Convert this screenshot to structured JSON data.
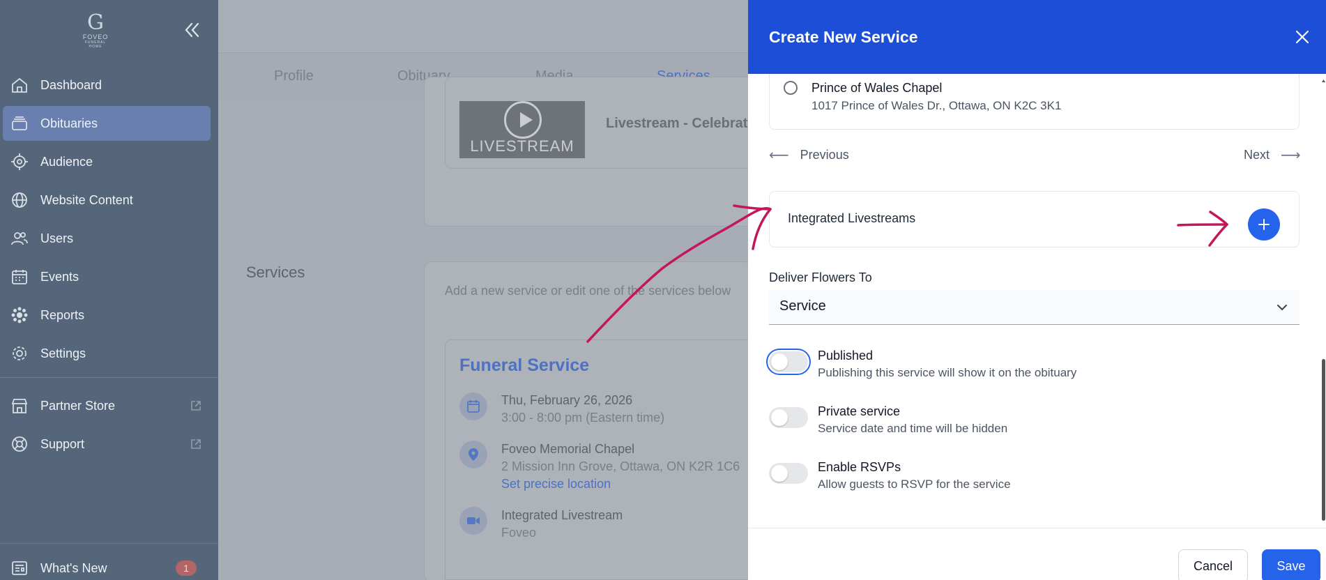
{
  "sidebar": {
    "logo": {
      "mark": "G",
      "name": "FOVEO",
      "sub": "FUNERAL HOME"
    },
    "items": [
      {
        "label": "Dashboard",
        "icon": "home-icon"
      },
      {
        "label": "Obituaries",
        "icon": "stack-icon",
        "active": true
      },
      {
        "label": "Audience",
        "icon": "target-icon"
      },
      {
        "label": "Website Content",
        "icon": "globe-icon"
      },
      {
        "label": "Users",
        "icon": "users-icon"
      },
      {
        "label": "Events",
        "icon": "calendar-icon"
      },
      {
        "label": "Reports",
        "icon": "reports-icon"
      },
      {
        "label": "Settings",
        "icon": "gear-icon"
      }
    ],
    "external": [
      {
        "label": "Partner Store",
        "icon": "store-icon"
      },
      {
        "label": "Support",
        "icon": "lifebuoy-icon"
      }
    ],
    "whats_new": {
      "label": "What's New",
      "badge": "1"
    }
  },
  "main": {
    "tabs": [
      "Profile",
      "Obituary",
      "Media",
      "Services"
    ],
    "active_tab": "Services",
    "livestream_thumb": "LIVESTREAM",
    "livestream_title": "Livestream - Celebrat",
    "section_title": "Services",
    "section_desc": "Add a new service or edit one of the services below",
    "service": {
      "title": "Funeral Service",
      "date": "Thu, February 26, 2026",
      "time": "3:00 - 8:00 pm (Eastern time)",
      "venue": "Foveo Memorial Chapel",
      "address": "2 Mission Inn Grove, Ottawa, ON K2R 1C6",
      "location_link": "Set precise location",
      "livestream_label": "Integrated Livestream",
      "livestream_provider": "Foveo"
    }
  },
  "modal": {
    "title": "Create New Service",
    "venue": {
      "name": "Prince of Wales Chapel",
      "address": "1017 Prince of Wales Dr., Ottawa, ON K2C 3K1"
    },
    "pager": {
      "previous": "Previous",
      "next": "Next"
    },
    "livestreams_label": "Integrated Livestreams",
    "deliver_label": "Deliver Flowers To",
    "deliver_value": "Service",
    "toggles": [
      {
        "title": "Published",
        "desc": "Publishing this service will show it on the obituary",
        "on": false
      },
      {
        "title": "Private service",
        "desc": "Service date and time will be hidden",
        "on": false
      },
      {
        "title": "Enable RSVPs",
        "desc": "Allow guests to RSVP for the service",
        "on": false
      }
    ],
    "cancel": "Cancel",
    "save": "Save"
  },
  "colors": {
    "primary": "#1d4ed8",
    "button": "#2563eb",
    "sidebar": "#55667a",
    "annotation": "#c2185b"
  }
}
